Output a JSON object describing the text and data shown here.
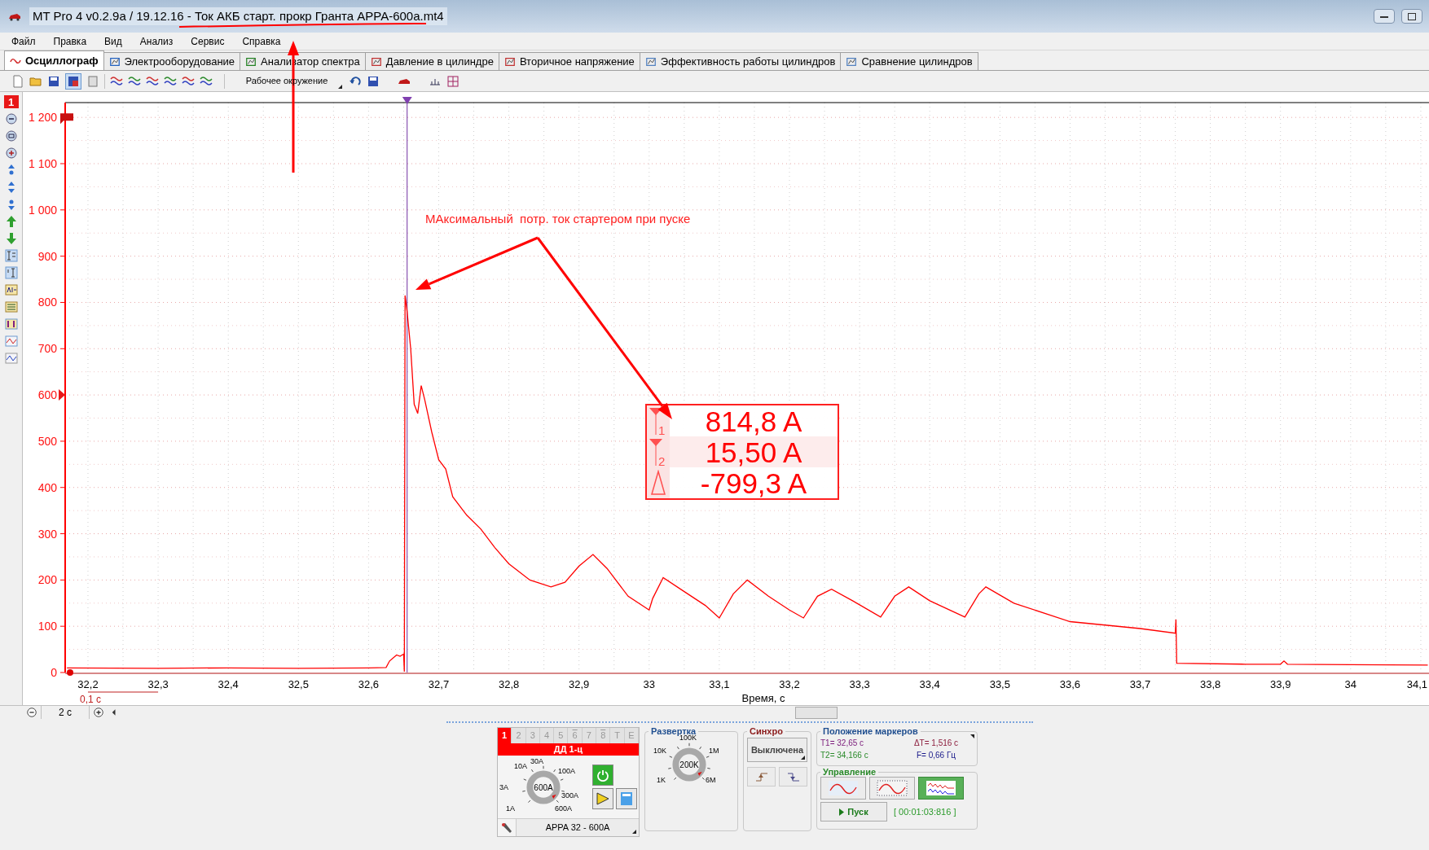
{
  "window": {
    "title": "MT Pro 4 v0.2.9a / 19.12.16 - Ток АКБ старт. прокр Гранта APPA-600a.mt4"
  },
  "menu": [
    "Файл",
    "Правка",
    "Вид",
    "Анализ",
    "Сервис",
    "Справка"
  ],
  "tabs": [
    {
      "label": "Осциллограф",
      "selected": true
    },
    {
      "label": "Электрооборудование",
      "selected": false
    },
    {
      "label": "Анализатор спектра",
      "selected": false
    },
    {
      "label": "Давление в цилиндре",
      "selected": false
    },
    {
      "label": "Вторичное напряжение",
      "selected": false
    },
    {
      "label": "Эффективность работы цилиндров",
      "selected": false
    },
    {
      "label": "Сравнение цилиндров",
      "selected": false
    }
  ],
  "toolbar": {
    "workspace": "Рабочее окружение"
  },
  "side_toolbar": {
    "channel": "1"
  },
  "chart": {
    "chart_data": {
      "type": "line",
      "xlabel": "Время, с",
      "x": [
        32.17,
        32.3,
        32.4,
        32.5,
        32.6,
        32.625,
        32.63,
        32.64,
        32.645,
        32.65,
        32.651,
        32.652,
        32.655,
        32.66,
        32.665,
        32.67,
        32.675,
        32.68,
        32.69,
        32.7,
        32.71,
        32.72,
        32.74,
        32.76,
        32.78,
        32.8,
        32.83,
        32.86,
        32.88,
        32.9,
        32.92,
        32.94,
        32.97,
        33,
        33.005,
        33.02,
        33.05,
        33.08,
        33.1,
        33.12,
        33.14,
        33.17,
        33.2,
        33.22,
        33.24,
        33.26,
        33.29,
        33.33,
        33.35,
        33.37,
        33.4,
        33.45,
        33.47,
        33.48,
        33.52,
        33.6,
        33.7,
        33.75,
        33.751,
        33.752,
        33.85,
        33.9,
        33.905,
        33.91,
        34,
        34.11
      ],
      "series": [
        {
          "color": "#ff0000",
          "values": [
            10,
            9,
            10,
            9,
            10,
            11,
            25,
            38,
            35,
            40,
            2,
            815,
            780,
            700,
            580,
            560,
            620,
            590,
            520,
            460,
            440,
            380,
            340,
            310,
            270,
            235,
            200,
            185,
            195,
            230,
            255,
            225,
            165,
            135,
            160,
            205,
            175,
            145,
            118,
            170,
            200,
            165,
            135,
            118,
            165,
            180,
            155,
            120,
            165,
            185,
            155,
            120,
            170,
            185,
            150,
            110,
            95,
            85,
            115,
            20,
            18,
            18,
            25,
            18,
            17,
            16
          ]
        }
      ],
      "xlim": [
        32.1675,
        34.1117
      ],
      "ylim": [
        0,
        1232
      ],
      "xticks": [
        {
          "value": 32.2,
          "label": "32,2"
        },
        {
          "value": 32.3,
          "label": "32,3"
        },
        {
          "value": 32.4,
          "label": "32,4"
        },
        {
          "value": 32.5,
          "label": "32,5"
        },
        {
          "value": 32.6,
          "label": "32,6"
        },
        {
          "value": 32.7,
          "label": "32,7"
        },
        {
          "value": 32.8,
          "label": "32,8"
        },
        {
          "value": 32.9,
          "label": "32,9"
        },
        {
          "value": 33,
          "label": "33"
        },
        {
          "value": 33.1,
          "label": "33,1"
        },
        {
          "value": 33.2,
          "label": "33,2"
        },
        {
          "value": 33.3,
          "label": "33,3"
        },
        {
          "value": 33.4,
          "label": "33,4"
        },
        {
          "value": 33.5,
          "label": "33,5"
        },
        {
          "value": 33.6,
          "label": "33,6"
        },
        {
          "value": 33.7,
          "label": "33,7"
        },
        {
          "value": 33.8,
          "label": "33,8"
        },
        {
          "value": 33.9,
          "label": "33,9"
        },
        {
          "value": 34,
          "label": "34"
        },
        {
          "value": 34.1,
          "label": "34,1"
        }
      ],
      "yticks": [
        {
          "value": 0,
          "label": "0"
        },
        {
          "value": 100,
          "label": "100"
        },
        {
          "value": 200,
          "label": "200"
        },
        {
          "value": 300,
          "label": "300"
        },
        {
          "value": 400,
          "label": "400"
        },
        {
          "value": 500,
          "label": "500"
        },
        {
          "value": 600,
          "label": "600"
        },
        {
          "value": 700,
          "label": "700"
        },
        {
          "value": 800,
          "label": "800"
        },
        {
          "value": 900,
          "label": "900"
        },
        {
          "value": 1000,
          "label": "1 000"
        },
        {
          "value": 1100,
          "label": "1 100"
        },
        {
          "value": 1200,
          "label": "1 200"
        }
      ],
      "grid": true,
      "ref_lines": [
        {
          "axis": "x",
          "value": 32.655,
          "color": "#7030a0"
        }
      ]
    },
    "scale_label": "0,1 с"
  },
  "readout": [
    {
      "kind": "t1",
      "marker": "1",
      "value": "814,8 A"
    },
    {
      "kind": "t2",
      "marker": "2",
      "value": "15,50 A"
    },
    {
      "kind": "delta",
      "value": "-799,3 A"
    }
  ],
  "note": "МАксимальный  потр. ток стартером при пуске",
  "zoom": {
    "value": "2 с"
  },
  "channel_panel": {
    "tabs": [
      {
        "label": "1",
        "selected": true,
        "overline": false
      },
      {
        "label": "2",
        "selected": false,
        "overline": false
      },
      {
        "label": "3",
        "selected": false,
        "overline": false
      },
      {
        "label": "4",
        "selected": false,
        "overline": false
      },
      {
        "label": "5",
        "selected": false,
        "overline": false
      },
      {
        "label": "6",
        "selected": false,
        "overline": true
      },
      {
        "label": "7",
        "selected": false,
        "overline": false
      },
      {
        "label": "8",
        "selected": false,
        "overline": true
      },
      {
        "label": "T",
        "selected": false,
        "overline": false
      },
      {
        "label": "E",
        "selected": false,
        "overline": false
      }
    ],
    "title": "ДД 1-ц",
    "knob_center": "600A",
    "knob_labels": [
      "10A",
      "30A",
      "100A",
      "3A",
      "300A",
      "1A",
      "600A"
    ],
    "sensor": "APPA 32 - 600A"
  },
  "sweep": {
    "title": "Развертка",
    "center": "200K",
    "labels": [
      "100K",
      "10K",
      "1M",
      "1K",
      "6M"
    ]
  },
  "sync": {
    "title": "Синхро",
    "mode": "Выключена"
  },
  "markers": {
    "title": "Положение маркеров",
    "items": [
      {
        "text": "T1= 32,65 с",
        "color": "#7a1a7a"
      },
      {
        "text": "ΔT= 1,516 с",
        "color": "#8b1a3a"
      },
      {
        "text": "T2= 34,166 с",
        "color": "#2a8a2a"
      },
      {
        "text": "F= 0,66 Гц",
        "color": "#1a1a8a"
      }
    ]
  },
  "control": {
    "title": "Управление",
    "modes": [
      {
        "kind": "sine",
        "selected": false
      },
      {
        "kind": "sine-dotted",
        "selected": false
      },
      {
        "kind": "multi",
        "selected": true
      }
    ],
    "start": "Пуск",
    "timer": "[ 00:01:03:816 ]"
  }
}
